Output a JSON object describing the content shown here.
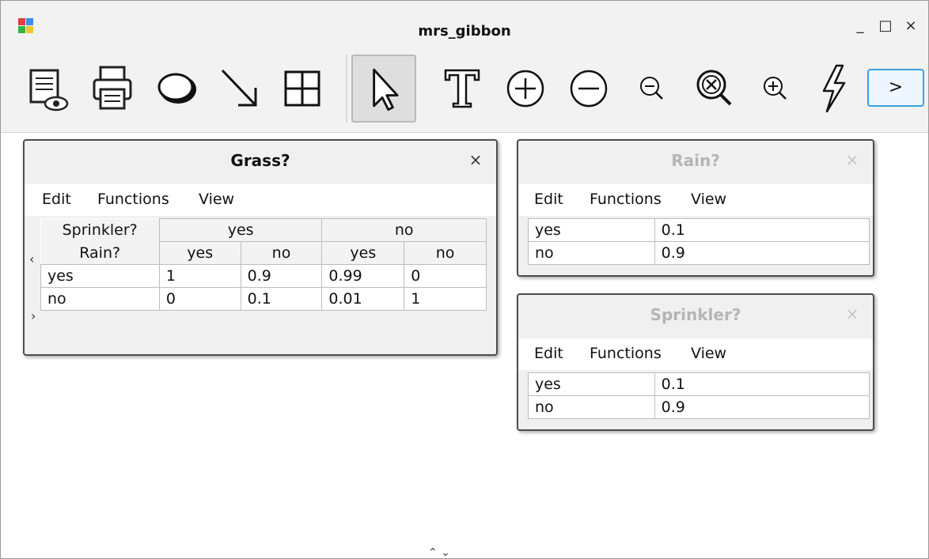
{
  "window": {
    "title": "mrs_gibbon",
    "buttons": {
      "minimize": "_",
      "maximize": "□",
      "close": "×"
    }
  },
  "toolbar": {
    "more_label": ">",
    "tools": [
      {
        "name": "report-view",
        "icon": "report-view-icon"
      },
      {
        "name": "print",
        "icon": "printer-icon"
      },
      {
        "name": "node",
        "icon": "ellipse-icon"
      },
      {
        "name": "arc",
        "icon": "arrow-icon"
      },
      {
        "name": "table",
        "icon": "table-icon"
      },
      {
        "name": "select",
        "icon": "pointer-icon",
        "selected": true
      },
      {
        "name": "text",
        "icon": "text-icon"
      },
      {
        "name": "add",
        "icon": "plus-circle-icon"
      },
      {
        "name": "remove",
        "icon": "minus-circle-icon"
      },
      {
        "name": "zoom-out",
        "icon": "zoom-out-icon"
      },
      {
        "name": "zoom-fit",
        "icon": "zoom-reset-icon"
      },
      {
        "name": "zoom-in",
        "icon": "zoom-in-icon"
      },
      {
        "name": "compile",
        "icon": "lightning-icon"
      }
    ]
  },
  "menus": {
    "edit": "Edit",
    "functions": "Functions",
    "view": "View"
  },
  "grass": {
    "title": "Grass?",
    "close": "×",
    "parent1": "Sprinkler?",
    "parent2": "Rain?",
    "p1_yes": "yes",
    "p1_no": "no",
    "p2_values": [
      "yes",
      "no",
      "yes",
      "no"
    ],
    "rows": [
      {
        "state": "yes",
        "values": [
          "1",
          "0.9",
          "0.99",
          "0"
        ]
      },
      {
        "state": "no",
        "values": [
          "0",
          "0.1",
          "0.01",
          "1"
        ]
      }
    ],
    "nav_left": "‹",
    "nav_right": "›"
  },
  "rain": {
    "title": "Rain?",
    "close": "×",
    "rows": [
      {
        "state": "yes",
        "value": "0.1"
      },
      {
        "state": "no",
        "value": "0.9"
      }
    ]
  },
  "sprinkler": {
    "title": "Sprinkler?",
    "close": "×",
    "rows": [
      {
        "state": "yes",
        "value": "0.1"
      },
      {
        "state": "no",
        "value": "0.9"
      }
    ]
  },
  "statusbar": {
    "arrows": "⌃ ⌄"
  }
}
